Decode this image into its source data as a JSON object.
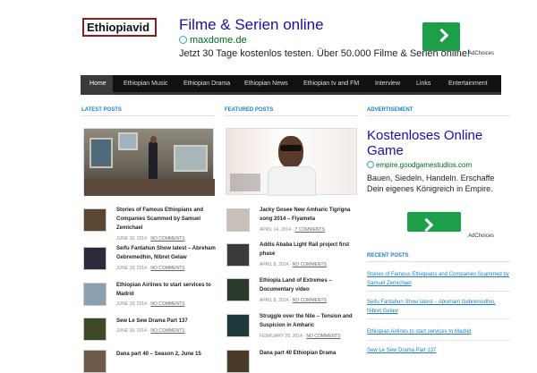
{
  "site": {
    "logo": "Ethiopiavid"
  },
  "top_ad": {
    "title": "Filme & Serien online",
    "url": "maxdome.de",
    "desc": "Jetzt 30 Tage kostenlos testen. Über 50.000 Filme & Serien online!",
    "adchoices": "AdChoices"
  },
  "nav": {
    "items": [
      "Home",
      "Ethiopian Music",
      "Ethiopian Drama",
      "Ethiopian News",
      "Ethiopian tv and FM",
      "Interview",
      "Links",
      "Entertainment"
    ]
  },
  "sections": {
    "latest": "LATEST POSTS",
    "featured": "FEATURED POSTS",
    "advertisement": "ADVERTISEMENT",
    "recent": "RECENT POSTS"
  },
  "latest_posts": [
    {
      "title": "Stories of Famous Ethiopians and Companies Scammed by Samuel Zemichael",
      "date": "JUNE 18, 2014",
      "comments": "NO COMMENTS"
    },
    {
      "title": "Seifu Fantahun Show latest – Abreham Gebremedhin, Nibret Gelaw",
      "date": "JUNE 18, 2014",
      "comments": "NO COMMENTS"
    },
    {
      "title": "Ethiopian Airlines to start services to Madrid",
      "date": "JUNE 18, 2014",
      "comments": "NO COMMENTS"
    },
    {
      "title": "Sew Le Sew Drama Part 137",
      "date": "JUNE 18, 2014",
      "comments": "NO COMMENTS"
    },
    {
      "title": "Dana part 40 – Season 2, June 15"
    }
  ],
  "featured_posts": [
    {
      "title": "Jacky Gosee New Amharic Tigrigna song 2014 – Fiyameta",
      "date": "APRIL 14, 2014",
      "comments": "7 COMMENTS"
    },
    {
      "title": "Addis Ababa Light Rail project first phase",
      "date": "APRIL 8, 2014",
      "comments": "NO COMMENTS"
    },
    {
      "title": "Ethiopia Land of Extremes – Documentary video",
      "date": "APRIL 8, 2014",
      "comments": "NO COMMENTS"
    },
    {
      "title": "Struggle over the Nile – Tension and Suspicion in Amharic",
      "date": "FEBRUARY 28, 2014",
      "comments": "NO COMMENTS"
    },
    {
      "title": "Dana part 40 Ethiopian Drama"
    }
  ],
  "side_ad": {
    "title": "Kostenloses Online Game",
    "url": "empire.goodgamestudios.com",
    "desc": "Bauen, Siedeln, Handeln. Erschaffe Dein eigenes Königreich in Empire.",
    "adchoices": "AdChoices"
  },
  "recent_posts": [
    "Stories of Famous Ethiopians and Companies Scammed by Samuel Zemichael",
    "Seifu Fantahun Show latest – Abreham Gebremedhin, Nibret Gelaw",
    "Ethiopian Airlines to start services to Madrid",
    "Sew Le Sew Drama Part 137"
  ],
  "thumb_colors": [
    "#5a4632",
    "#2b2b3a",
    "#8aa0b0",
    "#3d4a2a",
    "#6b5a4a"
  ],
  "feat_thumb_colors": [
    "#c8c0b8",
    "#3a3a3a",
    "#2a3a2a",
    "#1e3a3c",
    "#4a3a2a"
  ],
  "colors": {
    "accent": "#1e7fc0",
    "nav_bg": "#111111",
    "go_green": "#1d9e4b"
  }
}
